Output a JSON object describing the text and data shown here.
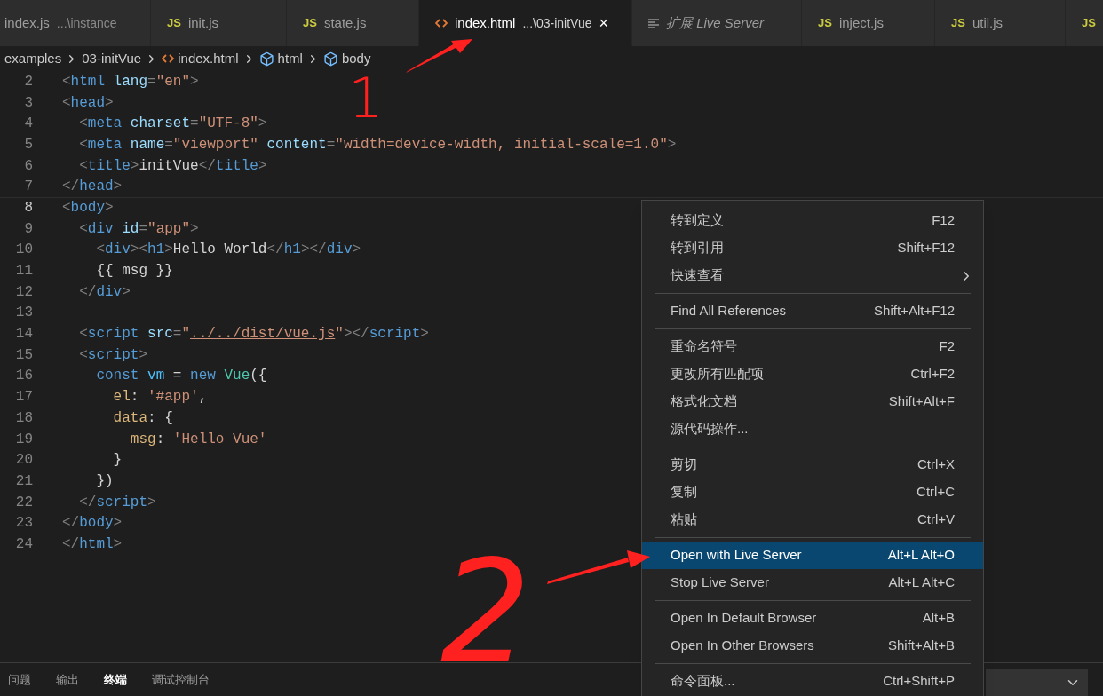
{
  "tabs": [
    {
      "kind": "plain",
      "name": "index.js",
      "description": "...\\instance",
      "selected": false
    },
    {
      "kind": "js",
      "badge": "JS",
      "name": "init.js",
      "selected": false
    },
    {
      "kind": "js",
      "badge": "JS",
      "name": "state.js",
      "selected": false
    },
    {
      "kind": "html",
      "name": "index.html",
      "description": "...\\03-initVue",
      "close": "×",
      "selected": true
    },
    {
      "kind": "preview",
      "name": "扩展 Live Server",
      "selected": false
    },
    {
      "kind": "js",
      "badge": "JS",
      "name": "inject.js",
      "selected": false
    },
    {
      "kind": "js",
      "badge": "JS",
      "name": "util.js",
      "selected": false
    },
    {
      "kind": "js",
      "badge": "JS",
      "selected": false
    }
  ],
  "breadcrumb": [
    {
      "kind": "folder",
      "label": "examples"
    },
    {
      "kind": "folder",
      "label": "03-initVue"
    },
    {
      "kind": "html",
      "label": "index.html"
    },
    {
      "kind": "element",
      "label": "html"
    },
    {
      "kind": "element",
      "label": "body"
    }
  ],
  "code": [
    {
      "number": "2",
      "current": false,
      "tokens": [
        {
          "kind": "p",
          "text": "<"
        },
        {
          "kind": "tag",
          "text": "html"
        },
        {
          "kind": "attr",
          "text": " lang"
        },
        {
          "kind": "p",
          "text": "="
        },
        {
          "kind": "str",
          "text": "\"en\""
        },
        {
          "kind": "p",
          "text": ">"
        }
      ]
    },
    {
      "number": "3",
      "current": false,
      "tokens": [
        {
          "kind": "p",
          "text": "<"
        },
        {
          "kind": "tag",
          "text": "head"
        },
        {
          "kind": "p",
          "text": ">"
        }
      ]
    },
    {
      "number": "4",
      "current": false,
      "tokens": [
        {
          "kind": "p",
          "text": "  <"
        },
        {
          "kind": "tag",
          "text": "meta"
        },
        {
          "kind": "attr",
          "text": " charset"
        },
        {
          "kind": "p",
          "text": "="
        },
        {
          "kind": "str",
          "text": "\"UTF-8\""
        },
        {
          "kind": "p",
          "text": ">"
        }
      ]
    },
    {
      "number": "5",
      "current": false,
      "tokens": [
        {
          "kind": "p",
          "text": "  <"
        },
        {
          "kind": "tag",
          "text": "meta"
        },
        {
          "kind": "attr",
          "text": " name"
        },
        {
          "kind": "p",
          "text": "="
        },
        {
          "kind": "str",
          "text": "\"viewport\""
        },
        {
          "kind": "attr",
          "text": " content"
        },
        {
          "kind": "p",
          "text": "="
        },
        {
          "kind": "str",
          "text": "\"width=device-width, initial-scale=1.0\""
        },
        {
          "kind": "p",
          "text": ">"
        }
      ]
    },
    {
      "number": "6",
      "current": false,
      "tokens": [
        {
          "kind": "p",
          "text": "  <"
        },
        {
          "kind": "tag",
          "text": "title"
        },
        {
          "kind": "p",
          "text": ">"
        },
        {
          "kind": "text",
          "text": "initVue"
        },
        {
          "kind": "p",
          "text": "</"
        },
        {
          "kind": "tag",
          "text": "title"
        },
        {
          "kind": "p",
          "text": ">"
        }
      ]
    },
    {
      "number": "7",
      "current": false,
      "tokens": [
        {
          "kind": "p",
          "text": "</"
        },
        {
          "kind": "tag",
          "text": "head"
        },
        {
          "kind": "p",
          "text": ">"
        }
      ]
    },
    {
      "number": "8",
      "current": true,
      "tokens": [
        {
          "kind": "p",
          "text": "<"
        },
        {
          "kind": "tag",
          "text": "body"
        },
        {
          "kind": "p",
          "text": ">"
        }
      ]
    },
    {
      "number": "9",
      "current": false,
      "tokens": [
        {
          "kind": "p",
          "text": "  <"
        },
        {
          "kind": "tag",
          "text": "div"
        },
        {
          "kind": "attr",
          "text": " id"
        },
        {
          "kind": "p",
          "text": "="
        },
        {
          "kind": "str",
          "text": "\"app\""
        },
        {
          "kind": "p",
          "text": ">"
        }
      ]
    },
    {
      "number": "10",
      "current": false,
      "tokens": [
        {
          "kind": "p",
          "text": "    <"
        },
        {
          "kind": "tag",
          "text": "div"
        },
        {
          "kind": "p",
          "text": "><"
        },
        {
          "kind": "tag",
          "text": "h1"
        },
        {
          "kind": "p",
          "text": ">"
        },
        {
          "kind": "text",
          "text": "Hello World"
        },
        {
          "kind": "p",
          "text": "</"
        },
        {
          "kind": "tag",
          "text": "h1"
        },
        {
          "kind": "p",
          "text": "></"
        },
        {
          "kind": "tag",
          "text": "div"
        },
        {
          "kind": "p",
          "text": ">"
        }
      ]
    },
    {
      "number": "11",
      "current": false,
      "tokens": [
        {
          "kind": "text",
          "text": "    {{ msg }}"
        }
      ]
    },
    {
      "number": "12",
      "current": false,
      "tokens": [
        {
          "kind": "p",
          "text": "  </"
        },
        {
          "kind": "tag",
          "text": "div"
        },
        {
          "kind": "p",
          "text": ">"
        }
      ]
    },
    {
      "number": "13",
      "current": false
    },
    {
      "number": "14",
      "current": false,
      "tokens": [
        {
          "kind": "p",
          "text": "  <"
        },
        {
          "kind": "tag",
          "text": "script"
        },
        {
          "kind": "attr",
          "text": " src"
        },
        {
          "kind": "p",
          "text": "="
        },
        {
          "kind": "str",
          "text": "\""
        },
        {
          "kind": "link",
          "text": "../../dist/vue.js"
        },
        {
          "kind": "str",
          "text": "\""
        },
        {
          "kind": "p",
          "text": "></"
        },
        {
          "kind": "tag",
          "text": "script"
        },
        {
          "kind": "p",
          "text": ">"
        }
      ]
    },
    {
      "number": "15",
      "current": false,
      "tokens": [
        {
          "kind": "p",
          "text": "  <"
        },
        {
          "kind": "tag",
          "text": "script"
        },
        {
          "kind": "p",
          "text": ">"
        }
      ]
    },
    {
      "number": "16",
      "current": false,
      "tokens": [
        {
          "kind": "kw",
          "text": "    const"
        },
        {
          "kind": "var",
          "text": " vm"
        },
        {
          "kind": "text",
          "text": " = "
        },
        {
          "kind": "kw",
          "text": "new"
        },
        {
          "kind": "cls",
          "text": " Vue"
        },
        {
          "kind": "text",
          "text": "({"
        }
      ]
    },
    {
      "number": "17",
      "current": false,
      "tokens": [
        {
          "kind": "key",
          "text": "      el"
        },
        {
          "kind": "text",
          "text": ": "
        },
        {
          "kind": "str",
          "text": "'#app'"
        },
        {
          "kind": "text",
          "text": ","
        }
      ]
    },
    {
      "number": "18",
      "current": false,
      "tokens": [
        {
          "kind": "key",
          "text": "      data"
        },
        {
          "kind": "text",
          "text": ": {"
        }
      ]
    },
    {
      "number": "19",
      "current": false,
      "tokens": [
        {
          "kind": "key",
          "text": "        msg"
        },
        {
          "kind": "text",
          "text": ": "
        },
        {
          "kind": "str",
          "text": "'Hello Vue'"
        }
      ]
    },
    {
      "number": "20",
      "current": false,
      "tokens": [
        {
          "kind": "text",
          "text": "      }"
        }
      ]
    },
    {
      "number": "21",
      "current": false,
      "tokens": [
        {
          "kind": "text",
          "text": "    })"
        }
      ]
    },
    {
      "number": "22",
      "current": false,
      "tokens": [
        {
          "kind": "p",
          "text": "  </"
        },
        {
          "kind": "tag",
          "text": "script"
        },
        {
          "kind": "p",
          "text": ">"
        }
      ]
    },
    {
      "number": "23",
      "current": false,
      "tokens": [
        {
          "kind": "p",
          "text": "</"
        },
        {
          "kind": "tag",
          "text": "body"
        },
        {
          "kind": "p",
          "text": ">"
        }
      ]
    },
    {
      "number": "24",
      "current": false,
      "tokens": [
        {
          "kind": "p",
          "text": "</"
        },
        {
          "kind": "tag",
          "text": "html"
        },
        {
          "kind": "p",
          "text": ">"
        }
      ]
    }
  ],
  "context_menu": [
    {
      "kind": "item",
      "label": "转到定义",
      "shortcut": "F12",
      "selected": false
    },
    {
      "kind": "item",
      "label": "转到引用",
      "shortcut": "Shift+F12",
      "selected": false
    },
    {
      "kind": "submenu",
      "label": "快速查看",
      "selected": false
    },
    {
      "kind": "separator"
    },
    {
      "kind": "item",
      "label": "Find All References",
      "shortcut": "Shift+Alt+F12",
      "selected": false
    },
    {
      "kind": "separator"
    },
    {
      "kind": "item",
      "label": "重命名符号",
      "shortcut": "F2",
      "selected": false
    },
    {
      "kind": "item",
      "label": "更改所有匹配项",
      "shortcut": "Ctrl+F2",
      "selected": false
    },
    {
      "kind": "item",
      "label": "格式化文档",
      "shortcut": "Shift+Alt+F",
      "selected": false
    },
    {
      "kind": "item",
      "label": "源代码操作...",
      "selected": false
    },
    {
      "kind": "separator"
    },
    {
      "kind": "item",
      "label": "剪切",
      "shortcut": "Ctrl+X",
      "selected": false
    },
    {
      "kind": "item",
      "label": "复制",
      "shortcut": "Ctrl+C",
      "selected": false
    },
    {
      "kind": "item",
      "label": "粘贴",
      "shortcut": "Ctrl+V",
      "selected": false
    },
    {
      "kind": "separator"
    },
    {
      "kind": "item",
      "label": "Open with Live Server",
      "shortcut": "Alt+L Alt+O",
      "selected": true
    },
    {
      "kind": "item",
      "label": "Stop Live Server",
      "shortcut": "Alt+L Alt+C",
      "selected": false
    },
    {
      "kind": "separator"
    },
    {
      "kind": "item",
      "label": "Open In Default Browser",
      "shortcut": "Alt+B",
      "selected": false
    },
    {
      "kind": "item",
      "label": "Open In Other Browsers",
      "shortcut": "Shift+Alt+B",
      "selected": false
    },
    {
      "kind": "separator"
    },
    {
      "kind": "item",
      "label": "命令面板...",
      "shortcut": "Ctrl+Shift+P",
      "selected": false
    }
  ],
  "panel_tabs": [
    {
      "label": "问题",
      "selected": false
    },
    {
      "label": "输出",
      "selected": false
    },
    {
      "label": "终端",
      "selected": true
    },
    {
      "label": "调试控制台",
      "selected": false
    }
  ],
  "annotations": [
    {
      "label": "1"
    },
    {
      "label": "2"
    }
  ]
}
